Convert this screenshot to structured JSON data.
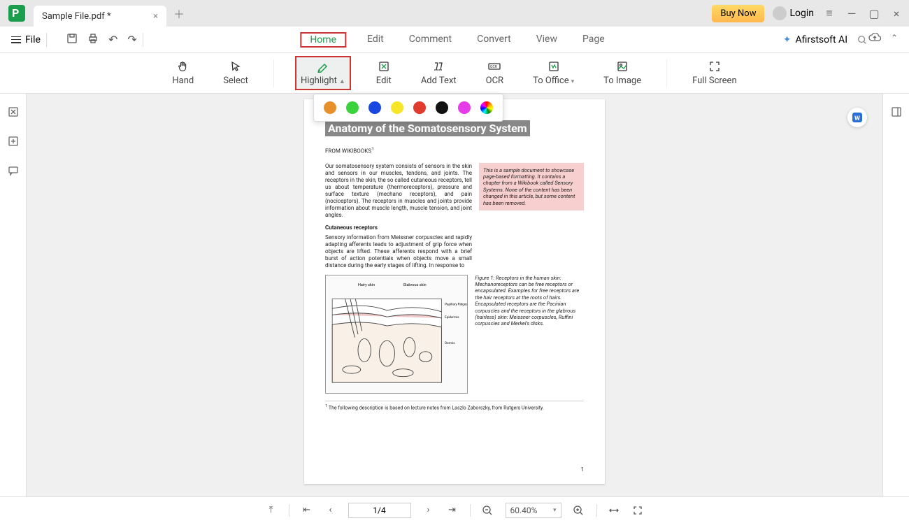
{
  "tab": {
    "title": "Sample File.pdf *"
  },
  "titlebar": {
    "buy_now": "Buy Now",
    "login": "Login"
  },
  "file_menu": {
    "label": "File"
  },
  "main_tabs": [
    "Home",
    "Edit",
    "Comment",
    "Convert",
    "View",
    "Page"
  ],
  "ai_brand": "Afirstsoft AI",
  "ribbon": {
    "hand": "Hand",
    "select": "Select",
    "highlight": "Highlight",
    "edit": "Edit",
    "add_text": "Add Text",
    "ocr": "OCR",
    "to_office": "To Office",
    "to_image": "To Image",
    "full_screen": "Full Screen"
  },
  "highlight_colors": [
    "#e8902c",
    "#3bd23b",
    "#1846e0",
    "#f7e52a",
    "#e03b2c",
    "#111111",
    "#e53be8"
  ],
  "document": {
    "title": "Anatomy of the Somatosensory System",
    "subtitle": "FROM WIKIBOOKS",
    "superscript": "1",
    "para1": "Our somatosensory system consists of sensors in the skin and sensors in our muscles, tendons, and joints. The receptors in the skin, the so called cutaneous receptors, tell us about temperature (thermoreceptors), pressure and surface texture (mechano receptors), and pain (nociceptors). The receptors in muscles and joints provide information about muscle length, muscle tension, and joint angles.",
    "note": "This is a sample document to showcase page-based formatting. It contains a chapter from a Wikibook called Sensory Systems. None of the content has been changed in this article, but some content has been removed.",
    "h2": "Cutaneous receptors",
    "para2": "Sensory information from Meissner corpuscles and rapidly adapting afferents leads to adjustment of grip force when objects are lifted. These afferents respond with a brief burst of action potentials when objects move a small distance during the early stages of lifting. In response to",
    "fig_label_hairy": "Hairy skin",
    "fig_label_glab": "Glabrous skin",
    "fig_label_epi": "Epidermis",
    "fig_label_dermis": "Dermis",
    "fig_label_pap": "Papillary Ridges",
    "fig_caption": "Figure 1:  Receptors in the human skin: Mechanoreceptors can be free receptors or encapsulated. Examples for free receptors are the hair receptors at the roots of hairs. Encapsulated receptors are the Pacinian corpuscles and the receptors in the glabrous (hairless) skin: Meissner corpuscles, Ruffini corpuscles and Merkel's disks.",
    "footnote": "The following description is based on lecture notes from Laszlo Zaborszky, from Rutgers University.",
    "page_number": "1"
  },
  "status": {
    "page": "1/4",
    "zoom": "60.40%"
  }
}
